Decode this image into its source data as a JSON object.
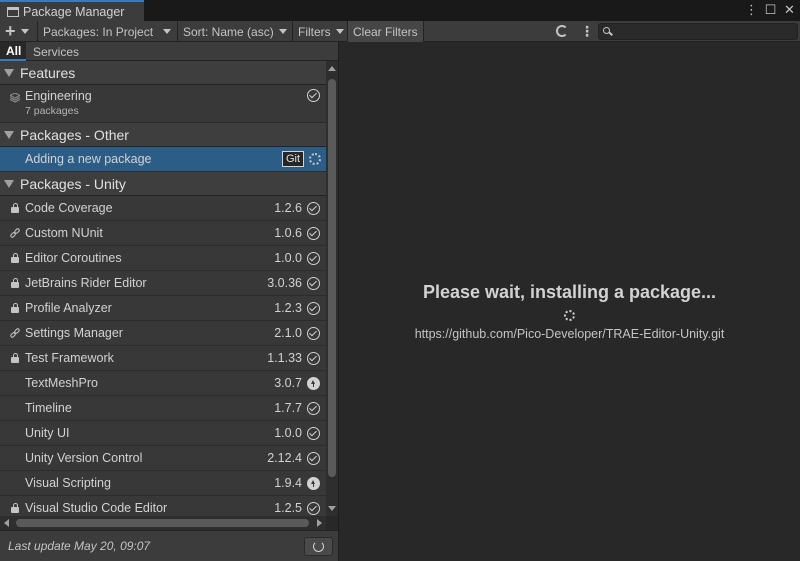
{
  "window": {
    "title": "Package Manager"
  },
  "toolbar": {
    "add_label": "+",
    "scope_label": "Packages: In Project",
    "sort_label": "Sort: Name (asc)",
    "filters_label": "Filters",
    "clear_filters_label": "Clear Filters",
    "search_value": ""
  },
  "subtabs": {
    "all": "All",
    "services": "Services"
  },
  "groups": {
    "features": {
      "label": "Features",
      "items": [
        {
          "name": "Engineering",
          "sub": "7 packages",
          "status": "installed"
        }
      ]
    },
    "other": {
      "label": "Packages - Other",
      "items": [
        {
          "name": "Adding a new package",
          "badge": "Git",
          "status": "loading"
        }
      ]
    },
    "unity": {
      "label": "Packages - Unity",
      "items": [
        {
          "name": "Code Coverage",
          "version": "1.2.6",
          "icon": "lock-icon",
          "status": "installed"
        },
        {
          "name": "Custom NUnit",
          "version": "1.0.6",
          "icon": "link-icon",
          "status": "installed"
        },
        {
          "name": "Editor Coroutines",
          "version": "1.0.0",
          "icon": "lock-icon",
          "status": "installed"
        },
        {
          "name": "JetBrains Rider Editor",
          "version": "3.0.36",
          "icon": "lock-icon",
          "status": "installed"
        },
        {
          "name": "Profile Analyzer",
          "version": "1.2.3",
          "icon": "lock-icon",
          "status": "installed"
        },
        {
          "name": "Settings Manager",
          "version": "2.1.0",
          "icon": "link-icon",
          "status": "installed"
        },
        {
          "name": "Test Framework",
          "version": "1.1.33",
          "icon": "lock-icon",
          "status": "installed"
        },
        {
          "name": "TextMeshPro",
          "version": "3.0.7",
          "icon": "",
          "status": "update"
        },
        {
          "name": "Timeline",
          "version": "1.7.7",
          "icon": "",
          "status": "installed"
        },
        {
          "name": "Unity UI",
          "version": "1.0.0",
          "icon": "",
          "status": "installed"
        },
        {
          "name": "Unity Version Control",
          "version": "2.12.4",
          "icon": "",
          "status": "installed"
        },
        {
          "name": "Visual Scripting",
          "version": "1.9.4",
          "icon": "",
          "status": "update"
        },
        {
          "name": "Visual Studio Code Editor",
          "version": "1.2.5",
          "icon": "lock-icon",
          "status": "installed"
        }
      ]
    }
  },
  "footer": {
    "last_update": "Last update May 20, 09:07"
  },
  "detail": {
    "title": "Please wait, installing a package...",
    "url": "https://github.com/Pico-Developer/TRAE-Editor-Unity.git"
  },
  "colors": {
    "accent": "#3a79bb",
    "selected_row": "#2c5d87",
    "panel": "#282828",
    "list": "#383838"
  }
}
